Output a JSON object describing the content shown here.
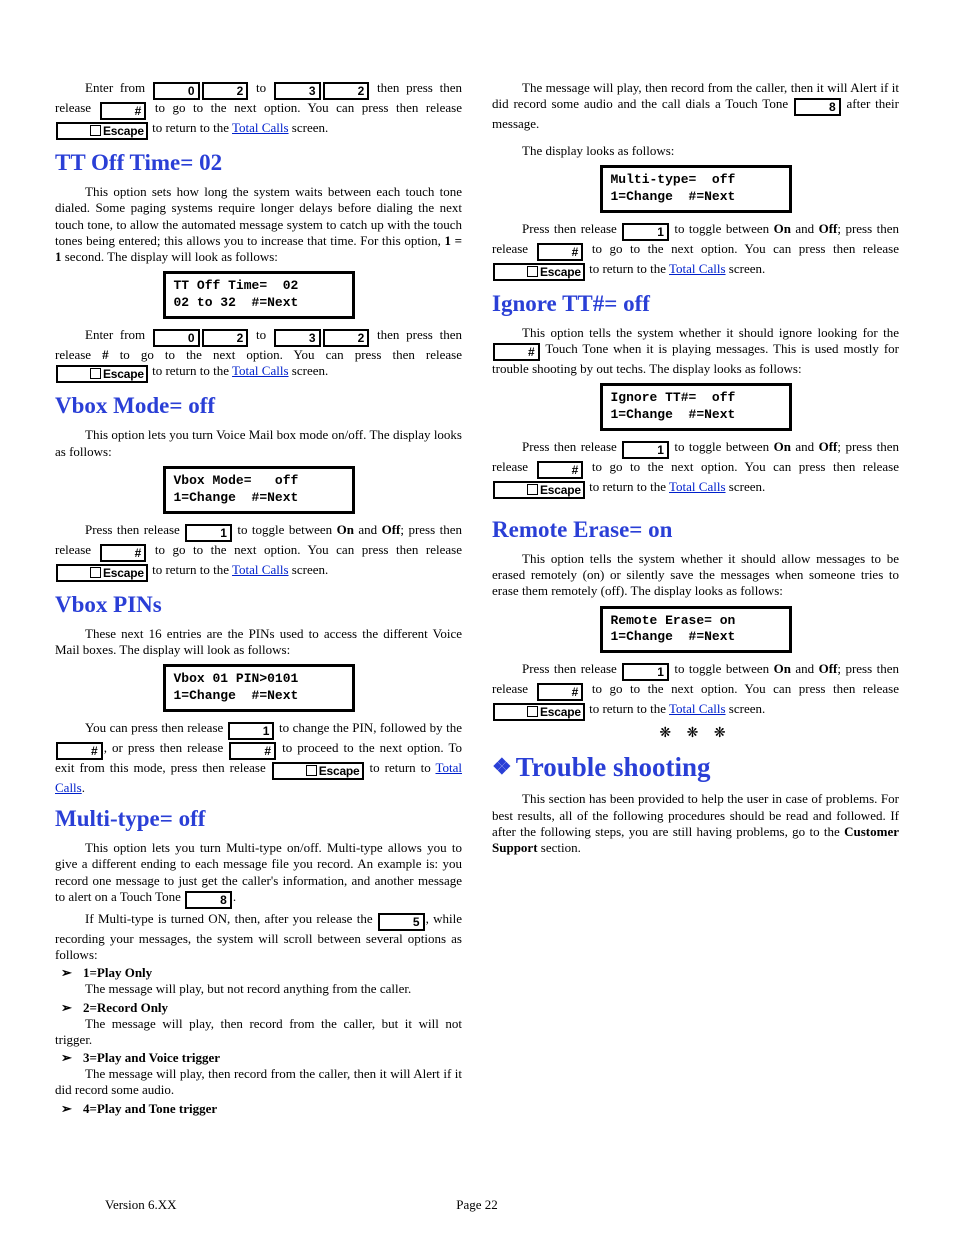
{
  "keys": {
    "n0": "0",
    "n1": "1",
    "n2": "2",
    "n3": "3",
    "n5": "5",
    "n8": "8",
    "hash": "#",
    "esc": "Escape"
  },
  "links": {
    "total_calls": "Total Calls"
  },
  "headings": {
    "tt_off": "TT Off Time=   02",
    "vbox_mode": "Vbox Mode=   off",
    "vbox_pins": "Vbox PINs",
    "multi_type": "Multi-type=   off",
    "ignore_tt": "Ignore TT#=   off",
    "remote_erase": "Remote Erase=   on",
    "trouble": "Trouble shooting"
  },
  "lcd": {
    "tt_off": "TT Off Time=  02\n02 to 32  #=Next",
    "vbox_mode": "Vbox Mode=   off\n1=Change  #=Next",
    "vbox_pin": "Vbox 01 PIN>0101\n1=Change  #=Next",
    "multi_type": "Multi-type=  off\n1=Change  #=Next",
    "ignore_tt": "Ignore TT#=  off\n1=Change  #=Next",
    "remote_erase": "Remote Erase= on\n1=Change  #=Next"
  },
  "para": {
    "intro1a": "Enter from ",
    "intro1b": " to ",
    "intro1c": " then press then release ",
    "intro1d": " to go to the next option.  You can press then release ",
    "intro1e": " to return to the ",
    "intro1f": " screen.",
    "tt_off_body": "This option sets how long the system waits between each touch tone dialed.  Some paging systems require longer delays before dialing the next touch tone, to allow the automated message system to catch up with the touch tones being entered; this allows you to increase that time.  For this option, ",
    "tt_off_body2a": "1 = 1",
    "tt_off_body2b": " second.  The display will look as follows:",
    "tt_off_after_a": "Enter from ",
    "tt_off_after_b": " to ",
    "tt_off_after_c": " then press then release ",
    "tt_off_after_c2": "#",
    "tt_off_after_d": " to go to the next option.  You can press then release ",
    "tt_off_after_e": " to return to the ",
    "tt_off_after_f": " screen.",
    "vbox_mode_body": "This option lets you turn Voice Mail box mode on/off.  The display looks as follows:",
    "toggle_a": "Press then release ",
    "toggle_b": " to toggle between ",
    "toggle_on": "On",
    "toggle_and": " and ",
    "toggle_off": "Off",
    "toggle_c": "; press then release ",
    "toggle_d": " to go to the next option. You can press then release ",
    "toggle_e": " to return to the ",
    "toggle_f": " screen.",
    "vbox_pins_body": "These next 16 entries are the PINs used to access the different Voice Mail boxes.  The display will look as follows:",
    "vbox_pins_after_a": "You can press then release ",
    "vbox_pins_after_b": " to change the PIN, followed by the ",
    "vbox_pins_after_c": ", or press then release ",
    "vbox_pins_after_d": " to proceed to the next option.  To exit from this mode, press then release ",
    "vbox_pins_after_e": " to return to ",
    "vbox_pins_after_f": ".",
    "multi_body_a": "This option lets you turn Multi-type on/off.  Multi-type allows you to give a different ending to each message file you record.  An example is:  you record one message to just get the caller's information, and another message to alert on a Touch Tone ",
    "multi_body_b": ".",
    "multi_body2_a": "If Multi-type is turned ON, then, after you release the ",
    "multi_body2_b": ", while recording your messages, the system will scroll between several options as follows:",
    "opt1_label": "1=Play Only",
    "opt1_text": "The message will play, but not record anything from the caller.",
    "opt2_label": "2=Record Only",
    "opt2_text": "The message will play, then record from the caller, but it will not trigger.",
    "opt3_label": "3=Play and Voice trigger",
    "opt3_text": "The message will play, then record from the caller, then it will Alert if it did record some audio.",
    "opt4_label": "4=Play and Tone trigger",
    "opt4_text_a": "The message will play, then record from the caller, then it will Alert if it did record some audio and the call dials a Touch Tone ",
    "opt4_text_b": " after their message.",
    "display_follows": "The display looks as follows:",
    "ignore_body_a": "This option tells the system whether it should ignore looking for the ",
    "ignore_body_b": " Touch Tone when it is playing messages.  This is used mostly for trouble shooting by out techs.  The display looks as follows:",
    "remote_body": "This option tells the system whether it should allow messages to be erased remotely (on) or silently save the messages when someone tries to erase them remotely (off).  The display looks as follows:",
    "stars": "❋ ❋ ❋",
    "trouble_body_a": "This section has been provided to help the user in case of problems.  For best results, all of the following procedures should be read and followed.  If after the following steps, you are still having problems, go to the ",
    "trouble_body_b": "Customer Support",
    "trouble_body_c": " section."
  },
  "footer": {
    "version": "Version 6.XX",
    "page": "Page 22"
  }
}
